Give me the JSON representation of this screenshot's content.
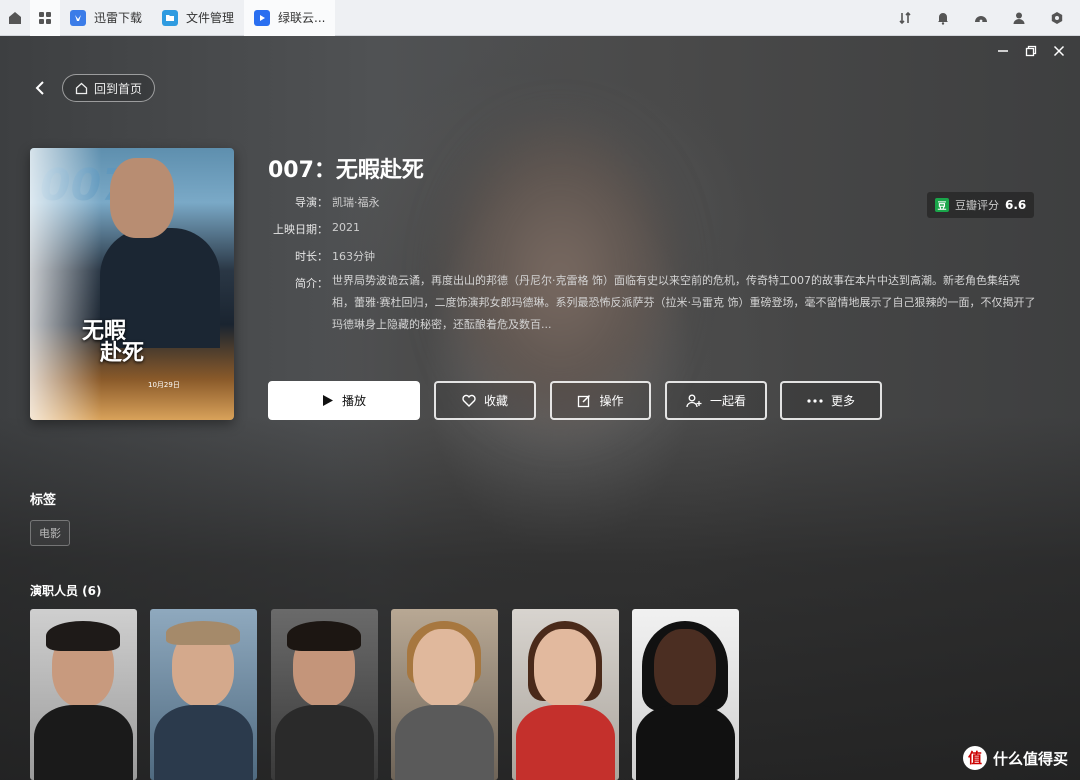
{
  "taskbar": {
    "tabs": [
      {
        "label": "迅雷下载",
        "icon": "thunder-icon",
        "color": "#3b7ce8"
      },
      {
        "label": "文件管理",
        "icon": "folder-icon",
        "color": "#2f9be0"
      },
      {
        "label": "绿联云...",
        "icon": "video-icon",
        "color": "#2a6ff0"
      }
    ]
  },
  "nav": {
    "home_label": "回到首页"
  },
  "movie": {
    "title": "007：无暇赴死",
    "director_key": "导演：",
    "director": "凯瑞·福永",
    "release_key": "上映日期：",
    "release": "2021",
    "duration_key": "时长：",
    "duration": "163分钟",
    "synopsis_key": "简介：",
    "synopsis": "世界局势波诡云谲，再度出山的邦德（丹尼尔·克雷格 饰）面临有史以来空前的危机，传奇特工007的故事在本片中达到高潮。新老角色集结亮相，蕾雅·赛杜回归，二度饰演邦女郎玛德琳。系列最恐怖反派萨芬（拉米·马雷克 饰）重磅登场，毫不留情地展示了自己狠辣的一面，不仅揭开了玛德琳身上隐藏的秘密，还酝酿着危及数百..."
  },
  "poster": {
    "big_text": "007",
    "title_line1": "无暇",
    "title_line2": "赴死",
    "date": "10月29日"
  },
  "rating": {
    "label": "豆瓣评分",
    "badge": "豆",
    "score": "6.6"
  },
  "buttons": {
    "play": "播放",
    "favorite": "收藏",
    "operate": "操作",
    "together": "一起看",
    "more": "更多"
  },
  "tags": {
    "title": "标签",
    "items": [
      "电影"
    ]
  },
  "cast": {
    "title": "演职人员 (6)"
  },
  "watermark": {
    "text": "什么值得买",
    "logo": "值"
  }
}
